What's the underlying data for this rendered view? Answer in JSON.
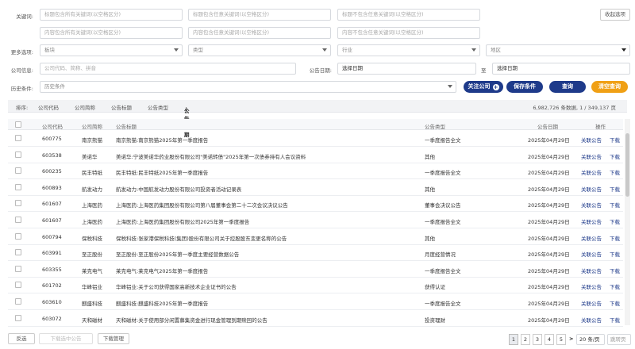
{
  "filters": {
    "keyword_label": "关键词:",
    "kw1": "标题包含所有关键词(以空格区分)",
    "kw2": "标题包含任意关键词(以空格区分)",
    "kw3": "标题不包含任意关键词(以空格区分)",
    "kw4": "内容包含所有关键词(以空格区分)",
    "kw5": "内容包含任意关键词(以空格区分)",
    "kw6": "内容不包含任意关键词(以空格区分)",
    "collapse_label": "收起选项",
    "more_label": "更多选项:",
    "sector": "板块",
    "type": "类型",
    "industry": "行业",
    "region": "地区",
    "company_label": "公司信息:",
    "company_placeholder": "公司代码、简称、拼音",
    "date_label": "公告日期:",
    "date_start": "选择日期",
    "date_sep": "至",
    "date_end": "选择日期",
    "history_label": "历史条件:",
    "history_value": "历史条件",
    "follow_btn": "关注公司",
    "save_btn": "保存条件",
    "query_btn": "查询",
    "clear_btn": "清空查询"
  },
  "sortbar": {
    "label": "排序:",
    "items": [
      "公司代码",
      "公司简称",
      "公告标题",
      "公告类型"
    ],
    "active": "公告日期",
    "arrow": "↓",
    "stats": "6,982,726 条数据, 1 / 349,137 页"
  },
  "table": {
    "headers": [
      "公司代码",
      "公司简称",
      "公告标题",
      "公告类型",
      "公告日期",
      "操作"
    ],
    "link_related": "关联公告",
    "link_download": "下载",
    "rows": [
      {
        "code": "600775",
        "name": "南京熊猫",
        "title": "南京熊猫:南京熊猫2025年第一季度报告",
        "type": "一季度报告全文",
        "date": "2025年04月29日"
      },
      {
        "code": "603538",
        "name": "美诺华",
        "title": "美诺华:宁波美诺华药业股份有限公司\"美诺转债\"2025年第一次债券持有人会议资料",
        "type": "其他",
        "date": "2025年04月29日"
      },
      {
        "code": "600235",
        "name": "民丰特纸",
        "title": "民丰特纸:民丰特纸2025年第一季度报告",
        "type": "一季度报告全文",
        "date": "2025年04月29日"
      },
      {
        "code": "600893",
        "name": "航发动力",
        "title": "航发动力:中国航发动力股份有限公司投资者活动记录表",
        "type": "其他",
        "date": "2025年04月29日"
      },
      {
        "code": "601607",
        "name": "上海医药",
        "title": "上海医药:上海医药集团股份有限公司第八届董事会第二十二次会议决议公告",
        "type": "董事会决议公告",
        "date": "2025年04月29日"
      },
      {
        "code": "601607",
        "name": "上海医药",
        "title": "上海医药:上海医药集团股份有限公司2025年第一季度报告",
        "type": "一季度报告全文",
        "date": "2025年04月29日"
      },
      {
        "code": "600794",
        "name": "保税科技",
        "title": "保税科技:张家港保税科技(集团)股份有限公司关于控股股东变更名称的公告",
        "type": "其他",
        "date": "2025年04月29日"
      },
      {
        "code": "603991",
        "name": "至正股份",
        "title": "至正股份:至正股份2025年第一季度主要经营数据公告",
        "type": "月度经营情况",
        "date": "2025年04月29日"
      },
      {
        "code": "603355",
        "name": "莱克电气",
        "title": "莱克电气:莱克电气2025年第一季度报告",
        "type": "一季度报告全文",
        "date": "2025年04月29日"
      },
      {
        "code": "601702",
        "name": "华峰铝业",
        "title": "华峰铝业:关于公司获得国家高新技术企业证书的公告",
        "type": "获得认证",
        "date": "2025年04月29日"
      },
      {
        "code": "603610",
        "name": "麒盛科技",
        "title": "麒盛科技:麒盛科技2025年第一季度报告",
        "type": "一季度报告全文",
        "date": "2025年04月29日"
      },
      {
        "code": "603072",
        "name": "天和磁材",
        "title": "天和磁材:关于使用部分闲置募集资金进行现金管理到期赎回的公告",
        "type": "投资理财",
        "date": "2025年04月29日"
      }
    ]
  },
  "footer": {
    "invert_btn": "反选",
    "download_selected": "下载选中公告",
    "manage_btn": "下载管理",
    "pages": [
      "1",
      "2",
      "3",
      "4",
      "5"
    ],
    "next": ">",
    "page_size": "20 条/页",
    "jump_placeholder": "跳转页"
  },
  "colors": {
    "navy": "#1e3a8a",
    "gold": "#f0a015"
  }
}
